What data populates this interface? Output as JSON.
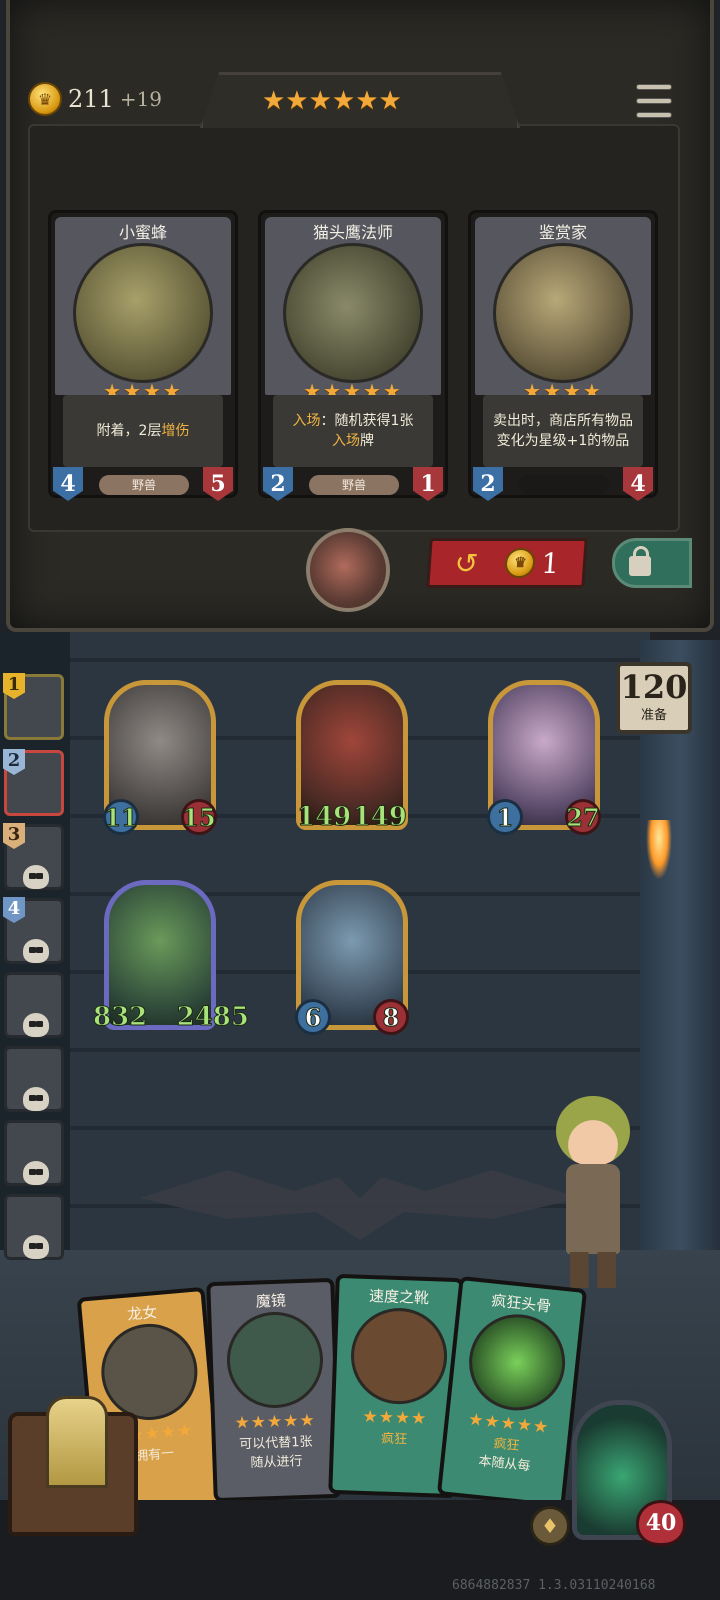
{
  "header": {
    "gold": "211",
    "gold_income": "+19",
    "tier_stars": "★★★★★★",
    "coin_symbol": "♛"
  },
  "shop": {
    "cards": [
      {
        "name": "小蜜蜂",
        "stars": "★★★★",
        "desc_pre": "附着，2层",
        "desc_hl": "增伤",
        "desc_post": "",
        "tribe": "野兽",
        "attack": "4",
        "health": "5"
      },
      {
        "name": "猫头鹰法师",
        "stars": "★★★★★",
        "desc_pre": "",
        "desc_hl": "入场",
        "desc_post": "：随机获得1张",
        "desc_line2_hl": "入场",
        "desc_line2": "牌",
        "tribe": "野兽",
        "attack": "2",
        "health": "1"
      },
      {
        "name": "鉴赏家",
        "stars": "★★★★",
        "desc_pre": "卖出时，商店所有物品变化为星级+1的物品",
        "desc_hl": "",
        "desc_post": "",
        "tribe": "",
        "attack": "2",
        "health": "4"
      }
    ],
    "reroll_cost": "1",
    "reroll_icon": "↺"
  },
  "board": {
    "turn_number": "120",
    "turn_label": "准备",
    "minions": [
      {
        "attack": "11",
        "health": "15"
      },
      {
        "attack": "149",
        "health": "149"
      },
      {
        "attack": "1",
        "health": "27"
      },
      {
        "attack": "832",
        "health": "2485"
      },
      {
        "attack": "6",
        "health": "8"
      }
    ]
  },
  "opponents": [
    {
      "rank": "1"
    },
    {
      "rank": "2"
    },
    {
      "rank": "3"
    },
    {
      "rank": "4"
    },
    {
      "rank": ""
    },
    {
      "rank": ""
    },
    {
      "rank": ""
    },
    {
      "rank": ""
    }
  ],
  "hand": [
    {
      "name": "龙女",
      "stars": "★★★★★",
      "desc": "拥有一",
      "desc2": "",
      "color": "#d9a14a"
    },
    {
      "name": "魔镜",
      "stars": "★★★★★",
      "desc": "可以代替1张",
      "desc2": "随从进行",
      "color": "#5b5d66"
    },
    {
      "name": "速度之靴",
      "stars": "★★★★",
      "desc": "疯狂",
      "desc2": "",
      "color": "#3c8a71"
    },
    {
      "name": "疯狂头骨",
      "stars": "★★★★★",
      "desc": "疯狂",
      "desc2": "本随从每",
      "color": "#3c8a71"
    }
  ],
  "player": {
    "health": "40"
  },
  "build_id": "6864882837 1.3.03110240168"
}
